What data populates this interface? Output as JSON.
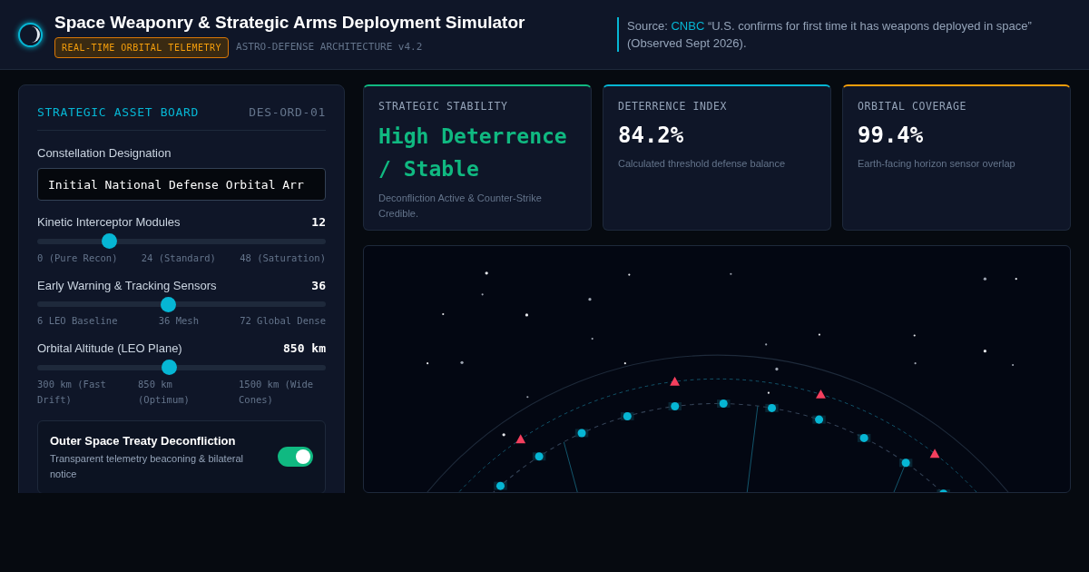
{
  "header": {
    "title": "Space Weaponry & Strategic Arms Deployment Simulator",
    "badge": "REAL-TIME ORBITAL TELEMETRY",
    "subtitle": "ASTRO-DEFENSE ARCHITECTURE v4.2",
    "source_label": "Source:",
    "source_link": "CNBC",
    "source_text": "“U.S. confirms for first time it has weapons deployed in space” (Observed Sept 2026)."
  },
  "panel": {
    "title": "STRATEGIC ASSET BOARD",
    "code": "DES-ORD-01",
    "field": {
      "label": "Constellation Designation",
      "value": "Initial National Defense Orbital Arr"
    },
    "sliders": [
      {
        "label": "Kinetic Interceptor Modules",
        "reading": "12",
        "level": 0.25,
        "ticks": [
          "0 (Pure Recon)",
          "24 (Standard)",
          "48 (Saturation)"
        ]
      },
      {
        "label": "Early Warning & Tracking Sensors",
        "reading": "36",
        "level": 0.455,
        "ticks": [
          "6 LEO Baseline",
          "36 Mesh",
          "72 Global Dense"
        ]
      },
      {
        "label": "Orbital Altitude (LEO Plane)",
        "reading": "850 km",
        "level": 0.458,
        "ticks": [
          "300 km (Fast Drift)",
          "850 km (Optimum)",
          "1500 km (Wide Cones)"
        ]
      }
    ],
    "toggle": {
      "title": "Outer Space Treaty Deconfliction",
      "description": "Transparent telemetry beaconing & bilateral notice",
      "on": true
    }
  },
  "cards": [
    {
      "label": "STRATEGIC STABILITY",
      "value": "High Deterrence / Stable",
      "note": "Deconfliction Active & Counter-Strike Credible.",
      "color": "#10b981"
    },
    {
      "label": "DETERRENCE INDEX",
      "value": "84.2%",
      "note": "Calculated threshold defense balance",
      "color": "#06b6d4"
    },
    {
      "label": "ORBITAL COVERAGE",
      "value": "99.4%",
      "note": "Earth-facing horizon sensor overlap",
      "color": "#f59e0b"
    }
  ]
}
